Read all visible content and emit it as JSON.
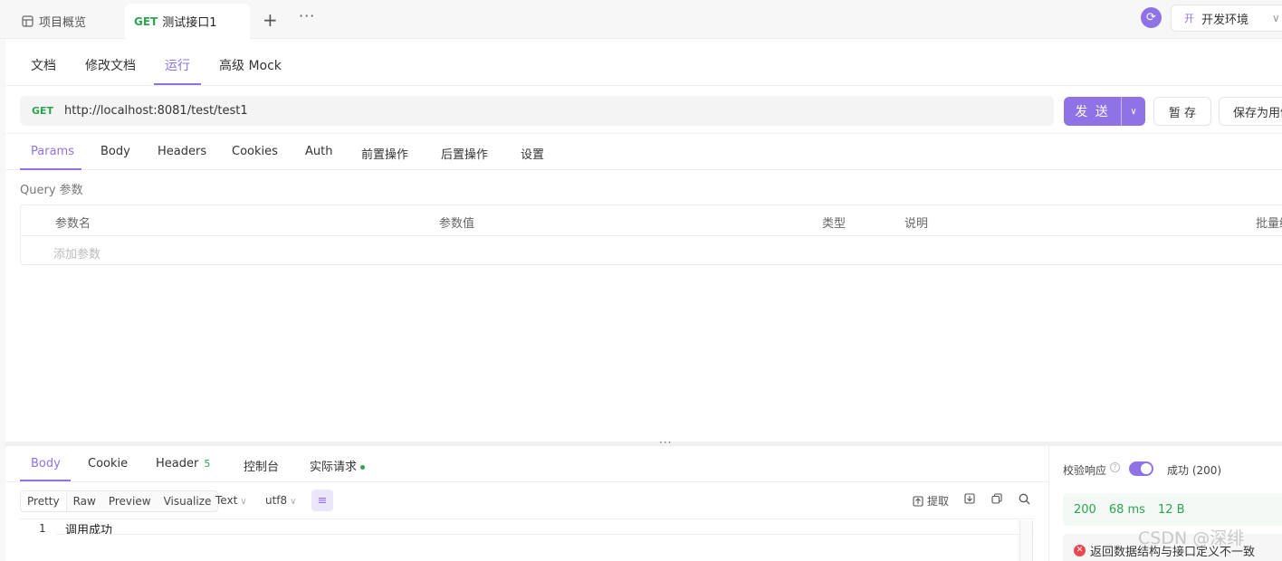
{
  "topbar": {
    "overview_label": "项目概览",
    "active_tab_method": "GET",
    "active_tab_title": "测试接口1",
    "add_label": "+",
    "more_label": "···",
    "env_badge": "开",
    "env_label": "开发环境"
  },
  "subnav": {
    "items": [
      "文档",
      "修改文档",
      "运行",
      "高级 Mock"
    ],
    "active": "运行"
  },
  "request": {
    "method": "GET",
    "url": "http://localhost:8081/test/test1",
    "send_label": "发 送",
    "stash_label": "暂 存",
    "save_as_label": "保存为用例"
  },
  "param_tabs": {
    "items": [
      "Params",
      "Body",
      "Headers",
      "Cookies",
      "Auth",
      "前置操作",
      "后置操作",
      "设置"
    ],
    "active": "Params"
  },
  "query": {
    "title": "Query 参数",
    "columns": [
      "参数名",
      "参数值",
      "类型",
      "说明",
      "批量编辑"
    ],
    "add_placeholder": "添加参数"
  },
  "response_tabs": {
    "items": [
      "Body",
      "Cookie",
      "Header",
      "控制台",
      "实际请求"
    ],
    "header_count": "5",
    "active": "Body"
  },
  "viewer": {
    "modes": [
      "Pretty",
      "Raw",
      "Preview",
      "Visualize"
    ],
    "active_mode": "Pretty",
    "format": "Text",
    "encoding": "utf8",
    "extract_label": "提取"
  },
  "body": {
    "lines": [
      {
        "num": "1",
        "text": "调用成功"
      }
    ]
  },
  "validation": {
    "label": "校验响应",
    "enabled": true,
    "result": "成功 (200)",
    "status_code": "200",
    "time": "68 ms",
    "size": "12 B",
    "error_text": "返回数据结构与接口定义不一致"
  },
  "watermark": "CSDN @深绯",
  "colors": {
    "accent": "#8f73e6",
    "get_method": "#2da44e",
    "error": "#e5484d"
  }
}
